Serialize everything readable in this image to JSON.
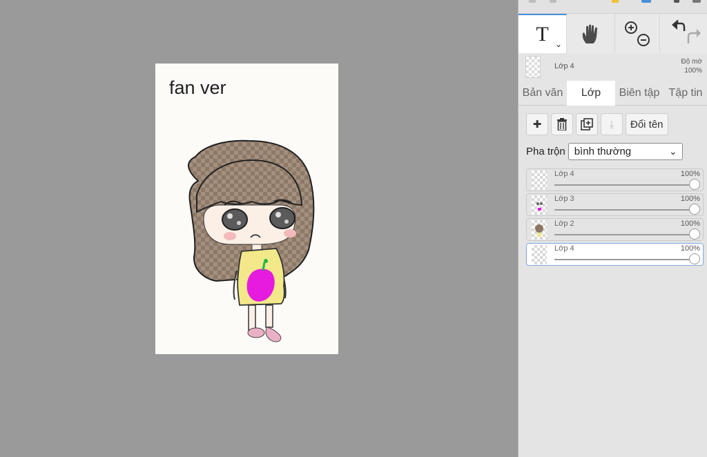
{
  "canvas": {
    "text": "fan ver"
  },
  "toolbar": {
    "text_tool_glyph": "T",
    "caret": "⌄",
    "hand_icon": "hand-icon",
    "zoom_icon": "zoom-icon",
    "undo_redo_icon": "undo-redo-icon"
  },
  "current_layer": {
    "name": "Lớp 4",
    "opacity_label": "Độ mờ",
    "opacity_value": "100%"
  },
  "tabs": [
    "Bản văn",
    "Lớp",
    "Biên tập",
    "Tập tin"
  ],
  "active_tab": 1,
  "layer_actions": {
    "add": "✚",
    "delete": "🗑",
    "duplicate": "⧉",
    "merge": "⤓",
    "rename": "Đổi tên"
  },
  "blend": {
    "label": "Pha trộn",
    "value": "bình thường",
    "caret": "⌄"
  },
  "layers": [
    {
      "name": "Lớp 4",
      "opacity": "100%",
      "opacity_value": 1.0,
      "selected": false
    },
    {
      "name": "Lớp 3",
      "opacity": "100%",
      "opacity_value": 1.0,
      "selected": false
    },
    {
      "name": "Lớp 2",
      "opacity": "100%",
      "opacity_value": 1.0,
      "selected": false
    },
    {
      "name": "Lớp 4",
      "opacity": "100%",
      "opacity_value": 1.0,
      "selected": true
    }
  ],
  "colors": {
    "workspace": "#9a9a9a",
    "panel": "#e5e5e5",
    "accent": "#4a90d9",
    "hair": "#8d7764",
    "shirt": "#f3e98a",
    "apple": "#e51ce0"
  }
}
